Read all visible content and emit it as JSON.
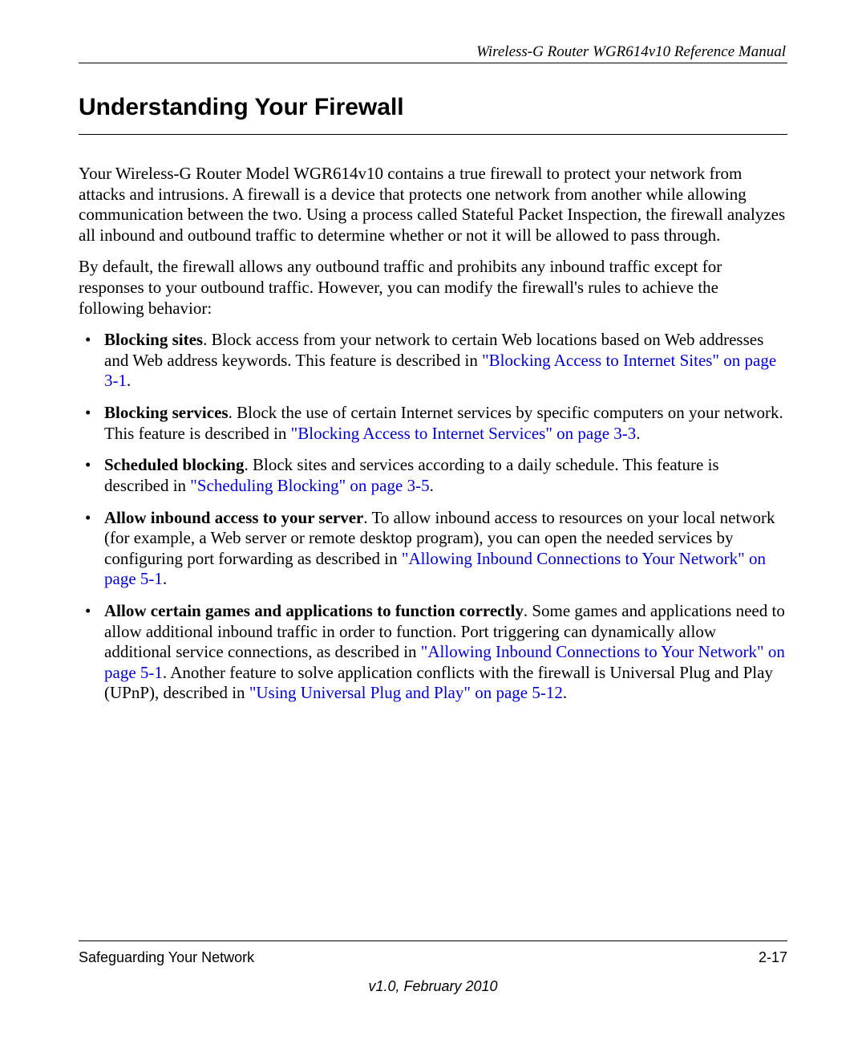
{
  "header": {
    "running_title": "Wireless-G Router WGR614v10 Reference Manual"
  },
  "section": {
    "title": "Understanding Your Firewall",
    "paragraphs": [
      "Your Wireless-G Router Model WGR614v10 contains a true firewall to protect your network from attacks and intrusions. A firewall is a device that protects one network from another while allowing communication between the two. Using a process called Stateful Packet Inspection, the firewall analyzes all inbound and outbound traffic to determine whether or not it will be allowed to pass through.",
      "By default, the firewall allows any outbound traffic and prohibits any inbound traffic except for responses to your outbound traffic. However, you can modify the firewall's rules to achieve the following behavior:"
    ],
    "bullets": [
      {
        "lead": "Blocking sites",
        "pre": ". Block access from your network to certain Web locations based on Web addresses and Web address keywords. This feature is described in ",
        "link": "\"Blocking Access to Internet Sites\" on page 3-1",
        "post": "."
      },
      {
        "lead": "Blocking services",
        "pre": ". Block the use of certain Internet services by specific computers on your network. This feature is described in ",
        "link": "\"Blocking Access to Internet Services\" on page 3-3",
        "post": "."
      },
      {
        "lead": "Scheduled blocking",
        "pre": ". Block sites and services according to a daily schedule. This feature is described in ",
        "link": "\"Scheduling Blocking\" on page 3-5",
        "post": "."
      },
      {
        "lead": "Allow inbound access to your server",
        "pre": ". To allow inbound access to resources on your local network (for example, a Web server or remote desktop program), you can open the needed services by configuring port forwarding as described in ",
        "link": "\"Allowing Inbound Connections to Your Network\" on page 5-1",
        "post": "."
      },
      {
        "lead": "Allow certain games and applications to function correctly",
        "pre": ". Some games and applications need to allow additional inbound traffic in order to function. Port triggering can dynamically allow additional service connections, as described in ",
        "link": "\"Allowing Inbound Connections to Your Network\" on page 5-1",
        "mid": ". Another feature to solve application conflicts with the firewall is Universal Plug and Play (UPnP), described in ",
        "link2": "\"Using Universal Plug and Play\" on page 5-12",
        "post": "."
      }
    ]
  },
  "footer": {
    "chapter": "Safeguarding Your Network",
    "page_number": "2-17",
    "version": "v1.0, February 2010"
  }
}
